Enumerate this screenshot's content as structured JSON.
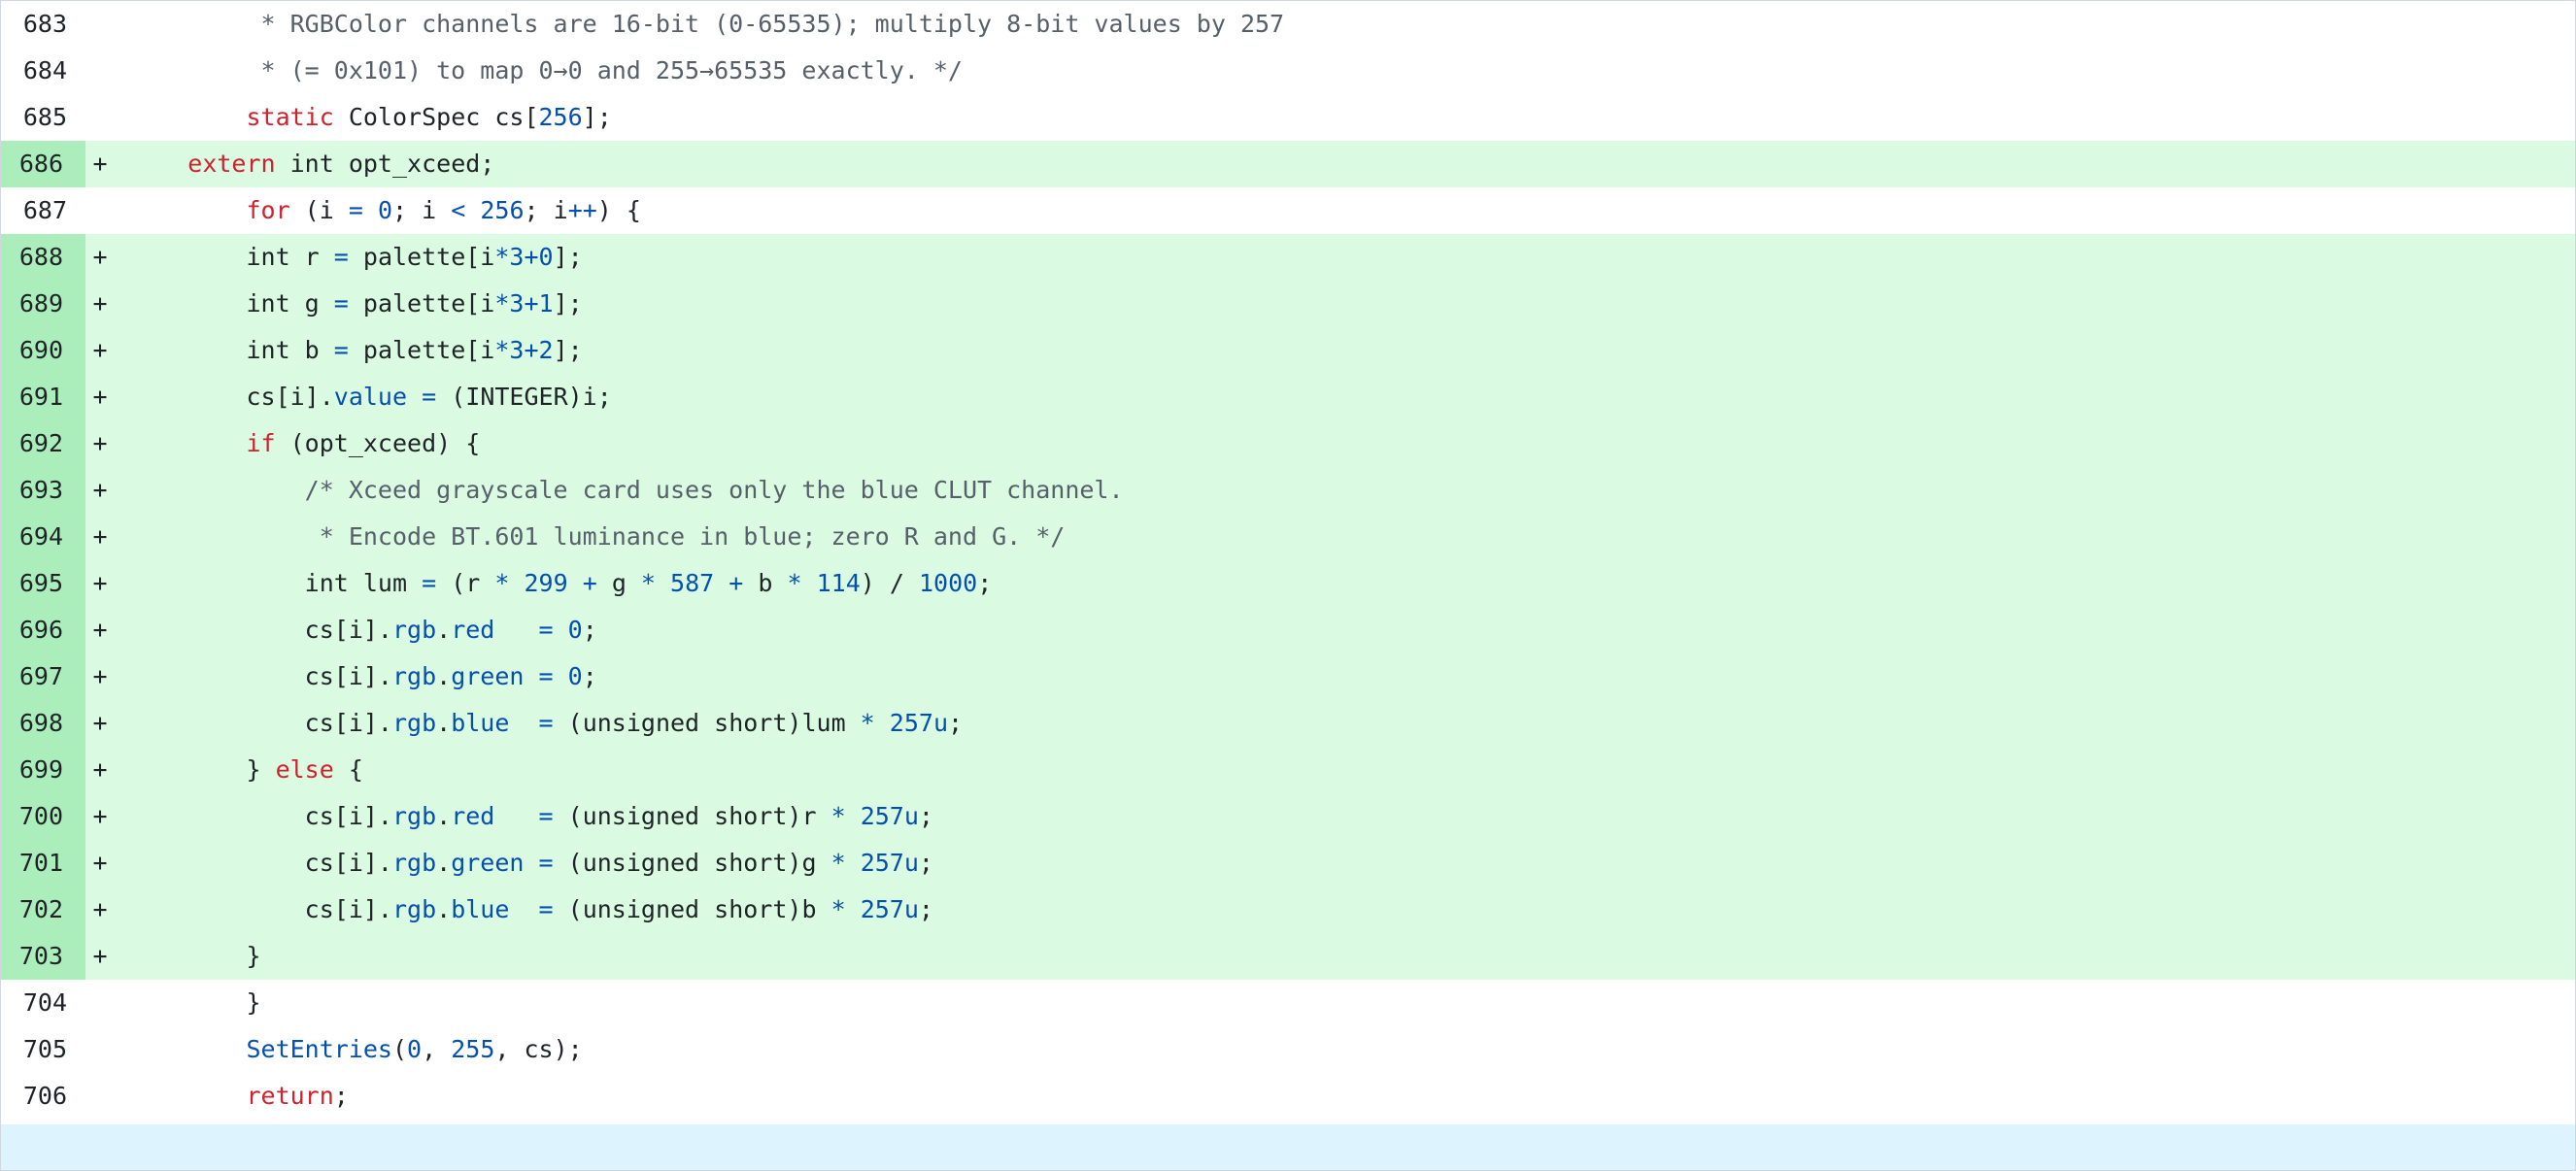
{
  "diff": {
    "lines": [
      {
        "no": "683",
        "sign": "",
        "type": "ctx",
        "tokens": [
          [
            "cmt",
            "          * RGBColor channels are 16-bit (0-65535); multiply 8-bit values by 257"
          ]
        ]
      },
      {
        "no": "684",
        "sign": "",
        "type": "ctx",
        "tokens": [
          [
            "cmt",
            "          * (= 0x101) to map 0→0 and 255→65535 exactly. */"
          ]
        ]
      },
      {
        "no": "685",
        "sign": "",
        "type": "ctx",
        "tokens": [
          [
            "pln",
            "         "
          ],
          [
            "kw",
            "static"
          ],
          [
            "pln",
            " ColorSpec cs["
          ],
          [
            "num-lit",
            "256"
          ],
          [
            "pln",
            "];"
          ]
        ]
      },
      {
        "no": "686",
        "sign": "+",
        "type": "add",
        "tokens": [
          [
            "pln",
            "     "
          ],
          [
            "kw",
            "extern"
          ],
          [
            "pln",
            " int opt_xceed;"
          ]
        ]
      },
      {
        "no": "687",
        "sign": "",
        "type": "ctx",
        "tokens": [
          [
            "pln",
            "         "
          ],
          [
            "kw",
            "for"
          ],
          [
            "pln",
            " (i "
          ],
          [
            "op",
            "="
          ],
          [
            "pln",
            " "
          ],
          [
            "num-lit",
            "0"
          ],
          [
            "pln",
            "; i "
          ],
          [
            "op",
            "<"
          ],
          [
            "pln",
            " "
          ],
          [
            "num-lit",
            "256"
          ],
          [
            "pln",
            "; i"
          ],
          [
            "op",
            "++"
          ],
          [
            "pln",
            ") {"
          ]
        ]
      },
      {
        "no": "688",
        "sign": "+",
        "type": "add",
        "tokens": [
          [
            "pln",
            "         int r "
          ],
          [
            "op",
            "="
          ],
          [
            "pln",
            " palette[i"
          ],
          [
            "op",
            "*"
          ],
          [
            "num-lit",
            "3"
          ],
          [
            "op",
            "+"
          ],
          [
            "num-lit",
            "0"
          ],
          [
            "pln",
            "];"
          ]
        ]
      },
      {
        "no": "689",
        "sign": "+",
        "type": "add",
        "tokens": [
          [
            "pln",
            "         int g "
          ],
          [
            "op",
            "="
          ],
          [
            "pln",
            " palette[i"
          ],
          [
            "op",
            "*"
          ],
          [
            "num-lit",
            "3"
          ],
          [
            "op",
            "+"
          ],
          [
            "num-lit",
            "1"
          ],
          [
            "pln",
            "];"
          ]
        ]
      },
      {
        "no": "690",
        "sign": "+",
        "type": "add",
        "tokens": [
          [
            "pln",
            "         int b "
          ],
          [
            "op",
            "="
          ],
          [
            "pln",
            " palette[i"
          ],
          [
            "op",
            "*"
          ],
          [
            "num-lit",
            "3"
          ],
          [
            "op",
            "+"
          ],
          [
            "num-lit",
            "2"
          ],
          [
            "pln",
            "];"
          ]
        ]
      },
      {
        "no": "691",
        "sign": "+",
        "type": "add",
        "tokens": [
          [
            "pln",
            "         cs[i]."
          ],
          [
            "prop",
            "value"
          ],
          [
            "pln",
            " "
          ],
          [
            "op",
            "="
          ],
          [
            "pln",
            " (INTEGER)i;"
          ]
        ]
      },
      {
        "no": "692",
        "sign": "+",
        "type": "add",
        "tokens": [
          [
            "pln",
            "         "
          ],
          [
            "kw",
            "if"
          ],
          [
            "pln",
            " (opt_xceed) {"
          ]
        ]
      },
      {
        "no": "693",
        "sign": "+",
        "type": "add",
        "tokens": [
          [
            "cmt",
            "             /* Xceed grayscale card uses only the blue CLUT channel."
          ]
        ]
      },
      {
        "no": "694",
        "sign": "+",
        "type": "add",
        "tokens": [
          [
            "cmt",
            "              * Encode BT.601 luminance in blue; zero R and G. */"
          ]
        ]
      },
      {
        "no": "695",
        "sign": "+",
        "type": "add",
        "tokens": [
          [
            "pln",
            "             int lum "
          ],
          [
            "op",
            "="
          ],
          [
            "pln",
            " (r "
          ],
          [
            "op",
            "*"
          ],
          [
            "pln",
            " "
          ],
          [
            "num-lit",
            "299"
          ],
          [
            "pln",
            " "
          ],
          [
            "op",
            "+"
          ],
          [
            "pln",
            " g "
          ],
          [
            "op",
            "*"
          ],
          [
            "pln",
            " "
          ],
          [
            "num-lit",
            "587"
          ],
          [
            "pln",
            " "
          ],
          [
            "op",
            "+"
          ],
          [
            "pln",
            " b "
          ],
          [
            "op",
            "*"
          ],
          [
            "pln",
            " "
          ],
          [
            "num-lit",
            "114"
          ],
          [
            "pln",
            ") / "
          ],
          [
            "num-lit",
            "1000"
          ],
          [
            "pln",
            ";"
          ]
        ]
      },
      {
        "no": "696",
        "sign": "+",
        "type": "add",
        "tokens": [
          [
            "pln",
            "             cs[i]."
          ],
          [
            "prop",
            "rgb"
          ],
          [
            "pln",
            "."
          ],
          [
            "prop",
            "red"
          ],
          [
            "pln",
            "   "
          ],
          [
            "op",
            "="
          ],
          [
            "pln",
            " "
          ],
          [
            "num-lit",
            "0"
          ],
          [
            "pln",
            ";"
          ]
        ]
      },
      {
        "no": "697",
        "sign": "+",
        "type": "add",
        "tokens": [
          [
            "pln",
            "             cs[i]."
          ],
          [
            "prop",
            "rgb"
          ],
          [
            "pln",
            "."
          ],
          [
            "prop",
            "green"
          ],
          [
            "pln",
            " "
          ],
          [
            "op",
            "="
          ],
          [
            "pln",
            " "
          ],
          [
            "num-lit",
            "0"
          ],
          [
            "pln",
            ";"
          ]
        ]
      },
      {
        "no": "698",
        "sign": "+",
        "type": "add",
        "tokens": [
          [
            "pln",
            "             cs[i]."
          ],
          [
            "prop",
            "rgb"
          ],
          [
            "pln",
            "."
          ],
          [
            "prop",
            "blue"
          ],
          [
            "pln",
            "  "
          ],
          [
            "op",
            "="
          ],
          [
            "pln",
            " (unsigned short)lum "
          ],
          [
            "op",
            "*"
          ],
          [
            "pln",
            " "
          ],
          [
            "num-lit",
            "257u"
          ],
          [
            "pln",
            ";"
          ]
        ]
      },
      {
        "no": "699",
        "sign": "+",
        "type": "add",
        "tokens": [
          [
            "pln",
            "         } "
          ],
          [
            "kw",
            "else"
          ],
          [
            "pln",
            " {"
          ]
        ]
      },
      {
        "no": "700",
        "sign": "+",
        "type": "add",
        "tokens": [
          [
            "pln",
            "             cs[i]."
          ],
          [
            "prop",
            "rgb"
          ],
          [
            "pln",
            "."
          ],
          [
            "prop",
            "red"
          ],
          [
            "pln",
            "   "
          ],
          [
            "op",
            "="
          ],
          [
            "pln",
            " (unsigned short)r "
          ],
          [
            "op",
            "*"
          ],
          [
            "pln",
            " "
          ],
          [
            "num-lit",
            "257u"
          ],
          [
            "pln",
            ";"
          ]
        ]
      },
      {
        "no": "701",
        "sign": "+",
        "type": "add",
        "tokens": [
          [
            "pln",
            "             cs[i]."
          ],
          [
            "prop",
            "rgb"
          ],
          [
            "pln",
            "."
          ],
          [
            "prop",
            "green"
          ],
          [
            "pln",
            " "
          ],
          [
            "op",
            "="
          ],
          [
            "pln",
            " (unsigned short)g "
          ],
          [
            "op",
            "*"
          ],
          [
            "pln",
            " "
          ],
          [
            "num-lit",
            "257u"
          ],
          [
            "pln",
            ";"
          ]
        ]
      },
      {
        "no": "702",
        "sign": "+",
        "type": "add",
        "tokens": [
          [
            "pln",
            "             cs[i]."
          ],
          [
            "prop",
            "rgb"
          ],
          [
            "pln",
            "."
          ],
          [
            "prop",
            "blue"
          ],
          [
            "pln",
            "  "
          ],
          [
            "op",
            "="
          ],
          [
            "pln",
            " (unsigned short)b "
          ],
          [
            "op",
            "*"
          ],
          [
            "pln",
            " "
          ],
          [
            "num-lit",
            "257u"
          ],
          [
            "pln",
            ";"
          ]
        ]
      },
      {
        "no": "703",
        "sign": "+",
        "type": "add",
        "tokens": [
          [
            "pln",
            "         }"
          ]
        ]
      },
      {
        "no": "704",
        "sign": "",
        "type": "ctx",
        "tokens": [
          [
            "pln",
            "         }"
          ]
        ]
      },
      {
        "no": "705",
        "sign": "",
        "type": "ctx",
        "tokens": [
          [
            "pln",
            "         "
          ],
          [
            "fn",
            "SetEntries"
          ],
          [
            "pln",
            "("
          ],
          [
            "num-lit",
            "0"
          ],
          [
            "pln",
            ", "
          ],
          [
            "num-lit",
            "255"
          ],
          [
            "pln",
            ", cs);"
          ]
        ]
      },
      {
        "no": "706",
        "sign": "",
        "type": "ctx",
        "tokens": [
          [
            "pln",
            "         "
          ],
          [
            "kw",
            "return"
          ],
          [
            "pln",
            ";"
          ]
        ]
      }
    ]
  }
}
